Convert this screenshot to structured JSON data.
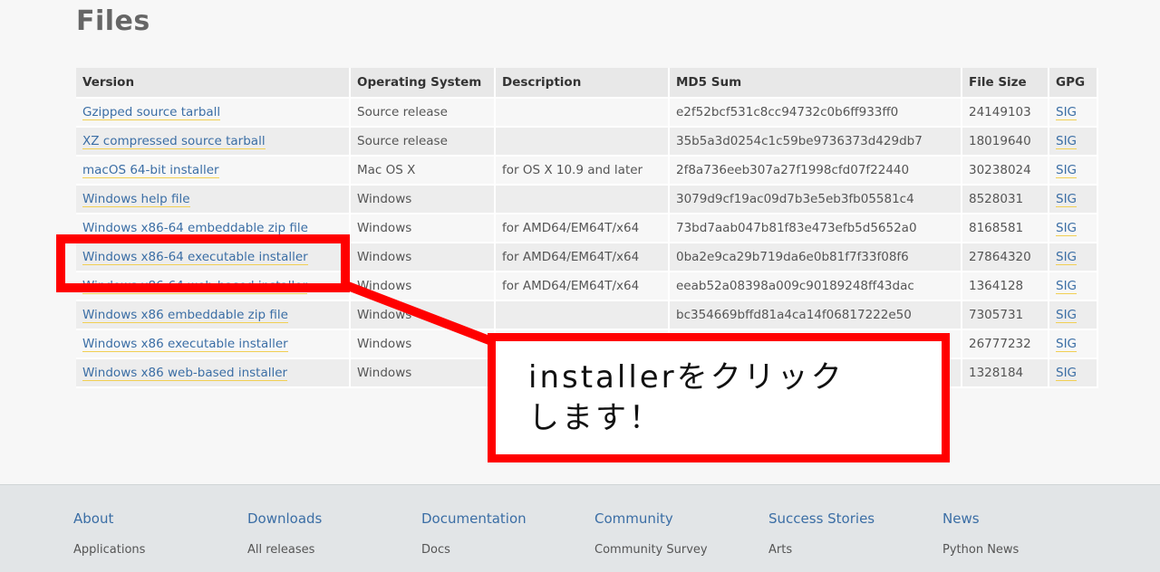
{
  "page": {
    "title": "Files"
  },
  "table": {
    "headers": [
      "Version",
      "Operating System",
      "Description",
      "MD5 Sum",
      "File Size",
      "GPG"
    ],
    "rows": [
      {
        "version": "Gzipped source tarball",
        "os": "Source release",
        "description": "",
        "md5": "e2f52bcf531c8cc94732c0b6ff933ff0",
        "size": "24149103",
        "gpg": "SIG"
      },
      {
        "version": "XZ compressed source tarball",
        "os": "Source release",
        "description": "",
        "md5": "35b5a3d0254c1c59be9736373d429db7",
        "size": "18019640",
        "gpg": "SIG"
      },
      {
        "version": "macOS 64-bit installer",
        "os": "Mac OS X",
        "description": "for OS X 10.9 and later",
        "md5": "2f8a736eeb307a27f1998cfd07f22440",
        "size": "30238024",
        "gpg": "SIG"
      },
      {
        "version": "Windows help file",
        "os": "Windows",
        "description": "",
        "md5": "3079d9cf19ac09d7b3e5eb3fb05581c4",
        "size": "8528031",
        "gpg": "SIG"
      },
      {
        "version": "Windows x86-64 embeddable zip file",
        "os": "Windows",
        "description": "for AMD64/EM64T/x64",
        "md5": "73bd7aab047b81f83e473efb5d5652a0",
        "size": "8168581",
        "gpg": "SIG"
      },
      {
        "version": "Windows x86-64 executable installer",
        "os": "Windows",
        "description": "for AMD64/EM64T/x64",
        "md5": "0ba2e9ca29b719da6e0b81f7f33f08f6",
        "size": "27864320",
        "gpg": "SIG"
      },
      {
        "version": "Windows x86-64 web-based installer",
        "os": "Windows",
        "description": "for AMD64/EM64T/x64",
        "md5": "eeab52a08398a009c90189248ff43dac",
        "size": "1364128",
        "gpg": "SIG"
      },
      {
        "version": "Windows x86 embeddable zip file",
        "os": "Windows",
        "description": "",
        "md5": "bc354669bffd81a4ca14f06817222e50",
        "size": "7305731",
        "gpg": "SIG"
      },
      {
        "version": "Windows x86 executable installer",
        "os": "Windows",
        "description": "",
        "md5": "",
        "size": "26777232",
        "gpg": "SIG"
      },
      {
        "version": "Windows x86 web-based installer",
        "os": "Windows",
        "description": "",
        "md5": "",
        "size": "1328184",
        "gpg": "SIG"
      }
    ]
  },
  "annotation": {
    "callout_line1": "installerをクリック",
    "callout_line2": "します！",
    "color": "#ff0000"
  },
  "footer": {
    "columns": [
      {
        "heading": "About",
        "link": "Applications"
      },
      {
        "heading": "Downloads",
        "link": "All releases"
      },
      {
        "heading": "Documentation",
        "link": "Docs"
      },
      {
        "heading": "Community",
        "link": "Community Survey"
      },
      {
        "heading": "Success Stories",
        "link": "Arts"
      },
      {
        "heading": "News",
        "link": "Python News"
      }
    ]
  }
}
